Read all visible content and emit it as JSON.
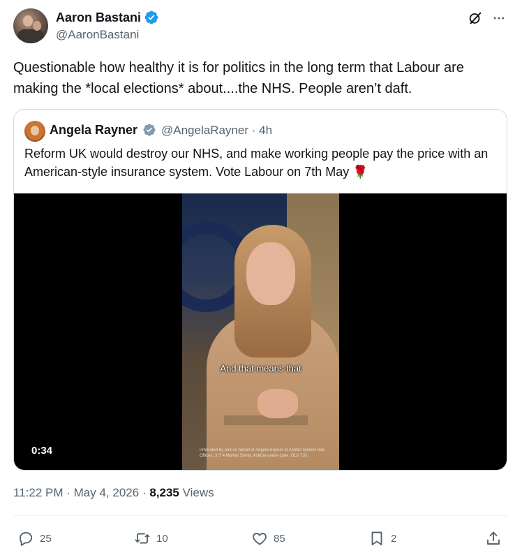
{
  "author": {
    "name": "Aaron Bastani",
    "handle": "@AaronBastani"
  },
  "tweet": {
    "text": "Questionable how healthy it is for politics in the long term that Labour are making the *local elections* about....the NHS.  People aren’t daft."
  },
  "quoted": {
    "name": "Angela Rayner",
    "handle": "@AngelaRayner",
    "time": "4h",
    "text": "Reform UK would destroy our NHS, and make working people pay the price with an American-style insurance system. Vote Labour on 7th May 🌹",
    "video": {
      "duration": "0:34",
      "caption": "And that means that",
      "credit": "Promoted by and on behalf of Angela Rayner at Ashton Market Hall Offices, 3 S 4 Market Street, Ashton-under-Lyne, OL6 7JU"
    }
  },
  "meta": {
    "time": "11:22 PM",
    "date": "May 4, 2026",
    "views_count": "8,235",
    "views_label": "Views"
  },
  "actions": {
    "replies": "25",
    "reposts": "10",
    "likes": "85",
    "bookmarks": "2"
  },
  "colors": {
    "verified": "#1d9bf0",
    "secondary_text": "#536471",
    "primary_text": "#0f1419"
  },
  "icons": [
    "grok-icon",
    "more-icon",
    "verified-badge-icon",
    "reply-icon",
    "repost-icon",
    "like-icon",
    "bookmark-icon",
    "share-icon"
  ]
}
